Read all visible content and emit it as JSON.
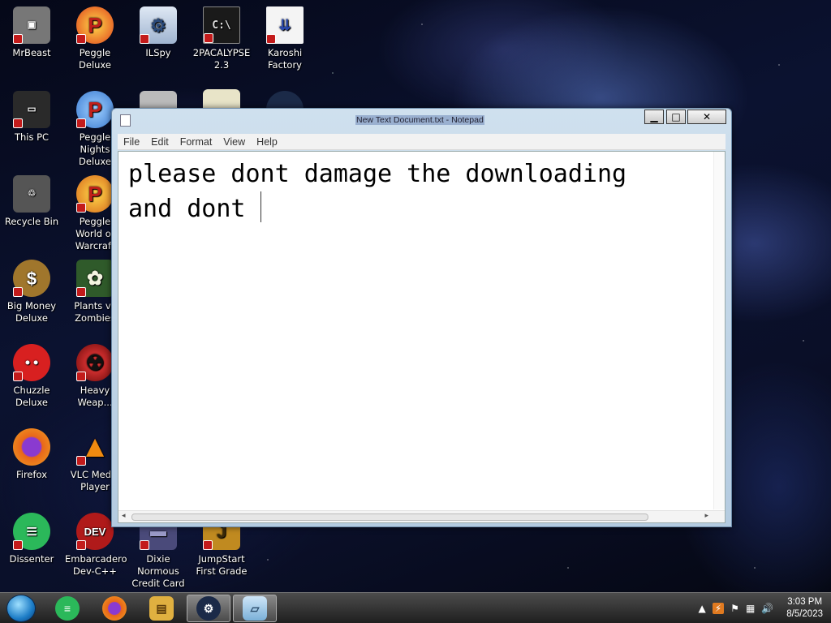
{
  "desktop_icons": [
    {
      "label": "MrBeast",
      "glyph": "▣",
      "color": "#6a6a6a"
    },
    {
      "label": "Peggle Deluxe",
      "glyph": "P",
      "color": "#e0421c"
    },
    {
      "label": "ILSpy",
      "glyph": "⚙",
      "color": "#7fa0d0"
    },
    {
      "label": "2PACALYPSE 2.3",
      "glyph": "C:\\",
      "color": "#222"
    },
    {
      "label": "Karoshi Factory",
      "glyph": "⇊",
      "color": "#f0f0f0"
    },
    {
      "label": "This PC",
      "glyph": "▭",
      "color": "#333"
    },
    {
      "label": "Peggle Nights Deluxe",
      "glyph": "P",
      "color": "#3a7ad0"
    },
    {
      "label": "Recycle Bin",
      "glyph": "🗑",
      "color": "#888"
    },
    {
      "label": "Peggle World of Warcraft",
      "glyph": "P",
      "color": "#d86a1c"
    },
    {
      "label": "Big Money Deluxe",
      "glyph": "$",
      "color": "#a0762c"
    },
    {
      "label": "Plants vs Zombies",
      "glyph": "✿",
      "color": "#5aa03a"
    },
    {
      "label": "Chuzzle Deluxe",
      "glyph": "●",
      "color": "#d82020"
    },
    {
      "label": "Heavy Weap...",
      "glyph": "☢",
      "color": "#b01818"
    },
    {
      "label": "Firefox",
      "glyph": "◉",
      "color": "#e8661a"
    },
    {
      "label": "VLC Media Player",
      "glyph": "▲",
      "color": "#f08a10"
    },
    {
      "label": "Dissenter",
      "glyph": "≡",
      "color": "#2bb85a"
    },
    {
      "label": "Embarcadero Dev-C++",
      "glyph": "DEV",
      "color": "#b01a1a"
    },
    {
      "label": "Dixie Normous Credit Card ...",
      "glyph": "▬",
      "color": "#5a5a8a"
    },
    {
      "label": "JumpStart First Grade",
      "glyph": "J",
      "color": "#c08a20"
    }
  ],
  "window": {
    "title": "New Text Document.txt - Notepad",
    "menu": [
      "File",
      "Edit",
      "Format",
      "View",
      "Help"
    ],
    "content": "please dont damage the downloading\nand dont",
    "controls": {
      "min": "▁",
      "max": "□",
      "close": "✕"
    }
  },
  "taskbar": {
    "apps": [
      {
        "name": "Dissenter",
        "glyph": "≡",
        "color": "#2bb85a"
      },
      {
        "name": "Firefox",
        "glyph": "◉",
        "color": "#e8661a"
      },
      {
        "name": "File Explorer",
        "glyph": "▤",
        "color": "#e0b040"
      },
      {
        "name": "Steam",
        "glyph": "⚙",
        "color": "#1b2a48"
      },
      {
        "name": "Notepad",
        "glyph": "▱",
        "color": "#7ab0d8"
      }
    ],
    "tray": {
      "time": "3:03 PM",
      "date": "8/5/2023"
    }
  }
}
